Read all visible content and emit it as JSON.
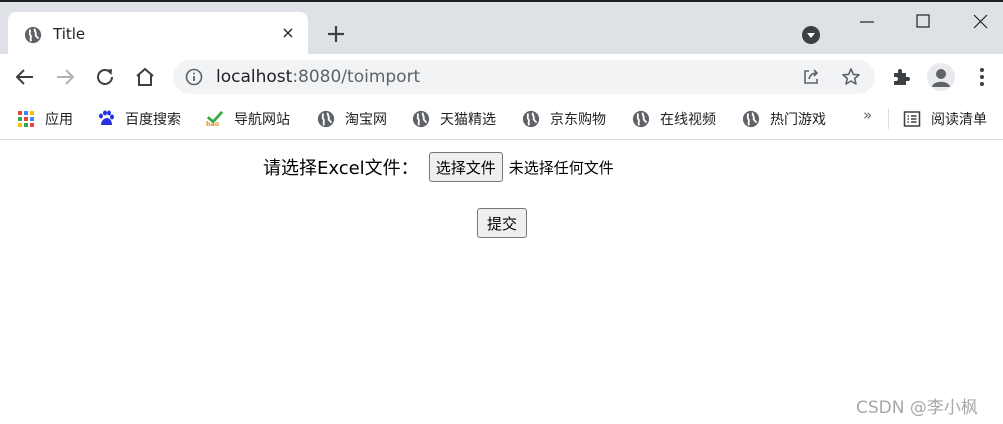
{
  "browser": {
    "tab": {
      "title": "Title",
      "close_icon": "×"
    },
    "address": {
      "host": "localhost",
      "rest": ":8080/toimport"
    },
    "bookmarks": [
      {
        "label": "应用",
        "icon": "apps-grid-icon"
      },
      {
        "label": "百度搜索",
        "icon": "baidu-paw-icon"
      },
      {
        "label": "导航网站",
        "icon": "hao-icon"
      },
      {
        "label": "淘宝网",
        "icon": "globe-icon"
      },
      {
        "label": "天猫精选",
        "icon": "globe-icon"
      },
      {
        "label": "京东购物",
        "icon": "globe-icon"
      },
      {
        "label": "在线视频",
        "icon": "globe-icon"
      },
      {
        "label": "热门游戏",
        "icon": "globe-icon"
      }
    ],
    "bookmarks_more": "»",
    "reading_list": "阅读清单"
  },
  "page": {
    "file_label": "请选择Excel文件：",
    "choose_file_button": "选择文件",
    "no_file_chosen": "未选择任何文件",
    "submit_button": "提交",
    "watermark": "CSDN @李小枫"
  }
}
